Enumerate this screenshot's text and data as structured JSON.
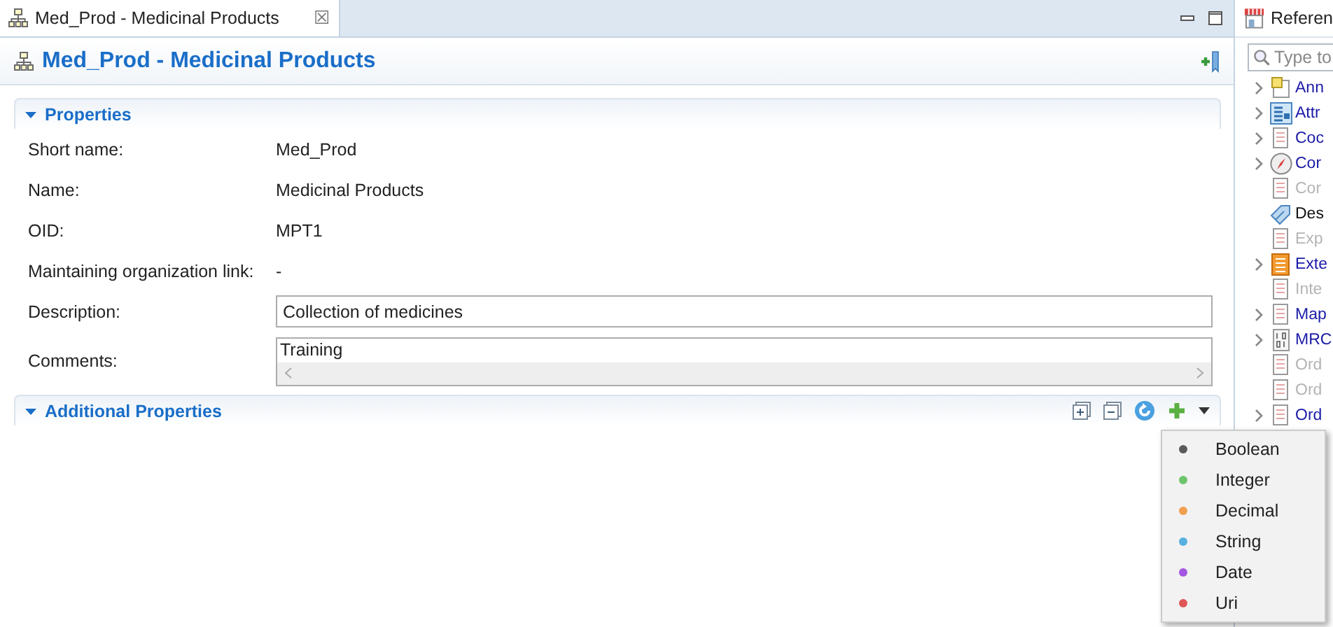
{
  "editor_tab": {
    "label": "Med_Prod - Medicinal Products",
    "close": "☒"
  },
  "header": {
    "title": "Med_Prod - Medicinal Products"
  },
  "properties": {
    "title": "Properties",
    "expanded": true,
    "fields": [
      {
        "kind": "text",
        "label": "Short name:",
        "value": "Med_Prod"
      },
      {
        "kind": "text",
        "label": "Name:",
        "value": "Medicinal Products"
      },
      {
        "kind": "text",
        "label": "OID:",
        "value": "MPT1"
      },
      {
        "kind": "text",
        "label": "Maintaining organization link:",
        "value": "-"
      },
      {
        "kind": "input",
        "label": "Description:",
        "value": "Collection of medicines"
      },
      {
        "kind": "textarea",
        "label": "Comments:",
        "value": "Training"
      }
    ]
  },
  "additional_properties": {
    "title": "Additional Properties",
    "expanded": true
  },
  "type_menu": [
    {
      "label": "Boolean",
      "color": "#5a5a5a"
    },
    {
      "label": "Integer",
      "color": "#6cc46c"
    },
    {
      "label": "Decimal",
      "color": "#f0a050"
    },
    {
      "label": "String",
      "color": "#58b0e0"
    },
    {
      "label": "Date",
      "color": "#a356e0"
    },
    {
      "label": "Uri",
      "color": "#e05656"
    }
  ],
  "reference_panel": {
    "title": "Referen",
    "search": {
      "placeholder": "Type to"
    },
    "items": [
      {
        "label": "Ann",
        "kind": "note",
        "disabled": false,
        "expandable": true
      },
      {
        "label": "Attr",
        "kind": "table",
        "disabled": false,
        "expandable": true
      },
      {
        "label": "Coc",
        "kind": "doc",
        "disabled": false,
        "expandable": true
      },
      {
        "label": "Cor",
        "kind": "compass",
        "disabled": false,
        "expandable": true
      },
      {
        "label": "Cor",
        "kind": "doc",
        "disabled": true,
        "expandable": false
      },
      {
        "label": "Des",
        "kind": "tag",
        "disabled": false,
        "expandable": false
      },
      {
        "label": "Exp",
        "kind": "doc",
        "disabled": true,
        "expandable": false
      },
      {
        "label": "Exte",
        "kind": "orange",
        "disabled": false,
        "expandable": true
      },
      {
        "label": "Inte",
        "kind": "doc",
        "disabled": true,
        "expandable": false
      },
      {
        "label": "Map",
        "kind": "doc",
        "disabled": false,
        "expandable": true
      },
      {
        "label": "MRC",
        "kind": "binary",
        "disabled": false,
        "expandable": true
      },
      {
        "label": "Ord",
        "kind": "doc",
        "disabled": true,
        "expandable": false
      },
      {
        "label": "Ord",
        "kind": "doc",
        "disabled": true,
        "expandable": false
      },
      {
        "label": "Ord",
        "kind": "doc",
        "disabled": false,
        "expandable": true
      }
    ]
  }
}
